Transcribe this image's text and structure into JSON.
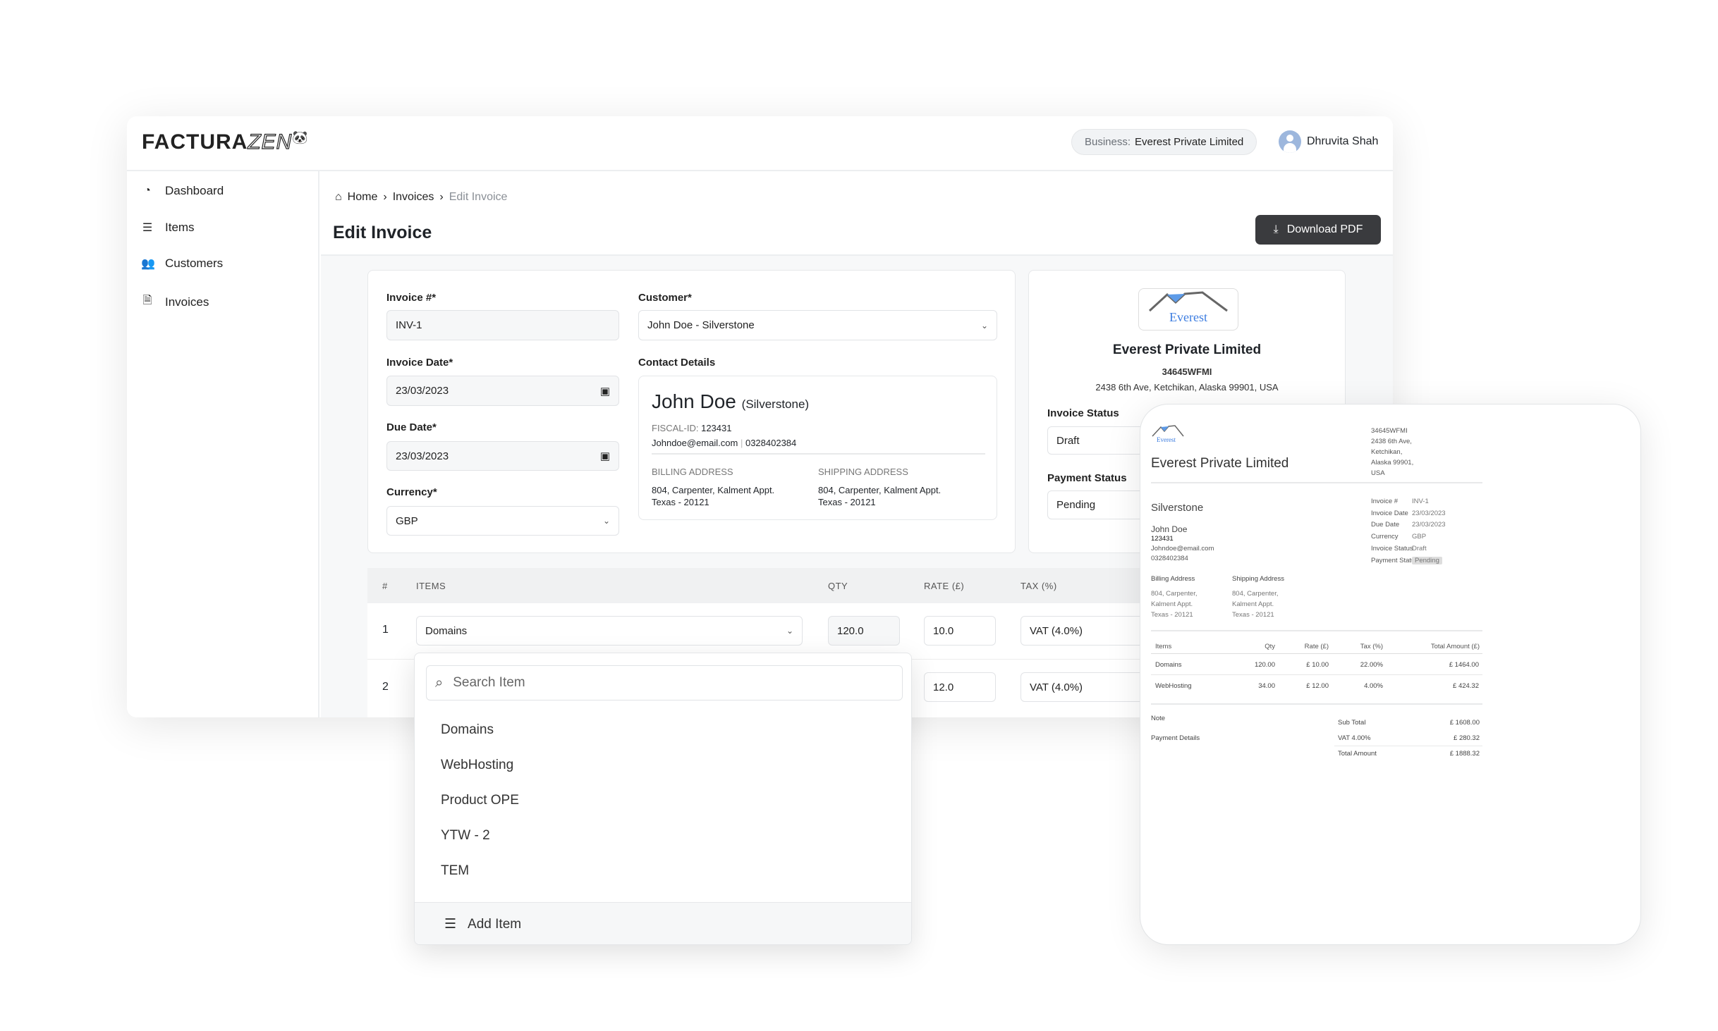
{
  "app": {
    "logo_text_bold": "FACTURA",
    "logo_text_outline": "ZEN"
  },
  "header": {
    "business_label": "Business:",
    "business_name": "Everest Private Limited",
    "user_name": "Dhruvita Shah"
  },
  "sidebar": {
    "items": [
      {
        "label": "Dashboard",
        "icon": "pie-chart-icon"
      },
      {
        "label": "Items",
        "icon": "list-icon"
      },
      {
        "label": "Customers",
        "icon": "users-icon"
      },
      {
        "label": "Invoices",
        "icon": "file-icon"
      }
    ]
  },
  "breadcrumb": {
    "home": "Home",
    "invoices": "Invoices",
    "current": "Edit Invoice"
  },
  "page": {
    "title": "Edit Invoice",
    "download_label": "Download PDF"
  },
  "form": {
    "invoice_no_label": "Invoice #*",
    "invoice_no": "INV-1",
    "invoice_date_label": "Invoice Date*",
    "invoice_date": "23/03/2023",
    "due_date_label": "Due Date*",
    "due_date": "23/03/2023",
    "currency_label": "Currency*",
    "currency": "GBP",
    "customer_label": "Customer*",
    "customer": "John Doe - Silverstone",
    "contact_label": "Contact Details"
  },
  "contact": {
    "name": "John Doe",
    "company": "(Silverstone)",
    "fiscal_label": "FISCAL-ID:",
    "fiscal_id": "123431",
    "email": "Johndoe@email.com",
    "phone": "0328402384",
    "billing_label": "BILLING ADDRESS",
    "billing_line1": "804, Carpenter, Kalment Appt.",
    "billing_line2": "Texas - 20121",
    "shipping_label": "SHIPPING ADDRESS",
    "shipping_line1": "804, Carpenter, Kalment Appt.",
    "shipping_line2": "Texas - 20121"
  },
  "business_card": {
    "logo_text": "Everest",
    "name": "Everest Private Limited",
    "code": "34645WFMI",
    "address": "2438 6th Ave, Ketchikan, Alaska 99901, USA",
    "invoice_status_label": "Invoice Status",
    "invoice_status": "Draft",
    "payment_status_label": "Payment Status",
    "payment_status": "Pending"
  },
  "items_table": {
    "headers": [
      "#",
      "ITEMS",
      "QTY",
      "RATE (£)",
      "TAX (%)"
    ],
    "rows": [
      {
        "n": "1",
        "item": "Domains",
        "qty": "120.0",
        "rate": "10.0",
        "tax": "VAT (4.0%)"
      },
      {
        "n": "2",
        "item": "",
        "qty": "",
        "rate": "12.0",
        "tax": "VAT (4.0%)"
      }
    ]
  },
  "item_dropdown": {
    "search_placeholder": "Search Item",
    "options": [
      "Domains",
      "WebHosting",
      "Product OPE",
      "YTW - 2",
      "TEM"
    ],
    "add_label": "Add Item"
  },
  "preview": {
    "logo_text": "Everest",
    "company": "Everest Private Limited",
    "address_lines": [
      "34645WFMI",
      "2438 6th Ave,",
      "Ketchikan,",
      "Alaska 99901,",
      "USA"
    ],
    "customer_company": "Silverstone",
    "customer_name": "John Doe",
    "customer_id": "123431",
    "customer_email": "Johndoe@email.com",
    "customer_phone": "0328402384",
    "meta": [
      {
        "k": "Invoice #",
        "v": "INV-1"
      },
      {
        "k": "Invoice Date",
        "v": "23/03/2023"
      },
      {
        "k": "Due Date",
        "v": "23/03/2023"
      },
      {
        "k": "Currency",
        "v": "GBP"
      },
      {
        "k": "Invoice Status",
        "v": "Draft"
      },
      {
        "k": "Payment Status",
        "v": "Pending"
      }
    ],
    "billing_label": "Billing Address",
    "billing": [
      "804, Carpenter,",
      "Kalment Appt.",
      "Texas - 20121"
    ],
    "shipping_label": "Shipping Address",
    "shipping": [
      "804, Carpenter,",
      "Kalment Appt.",
      "Texas - 20121"
    ],
    "table_headers": [
      "Items",
      "Qty",
      "Rate (£)",
      "Tax (%)",
      "Total Amount (£)"
    ],
    "rows": [
      [
        "Domains",
        "120.00",
        "£ 10.00",
        "22.00%",
        "£ 1464.00"
      ],
      [
        "WebHosting",
        "34.00",
        "£ 12.00",
        "4.00%",
        "£ 424.32"
      ]
    ],
    "note_label": "Note",
    "payment_details_label": "Payment Details",
    "subtotal_label": "Sub Total",
    "subtotal": "£ 1608.00",
    "vat_label": "VAT 4.00%",
    "vat": "£ 280.32",
    "total_label": "Total Amount",
    "total": "£ 1888.32"
  },
  "colors": {
    "button_dark": "#3a3b3e",
    "avatar": "#9db7dd",
    "brand_blue": "#3d7de0"
  }
}
